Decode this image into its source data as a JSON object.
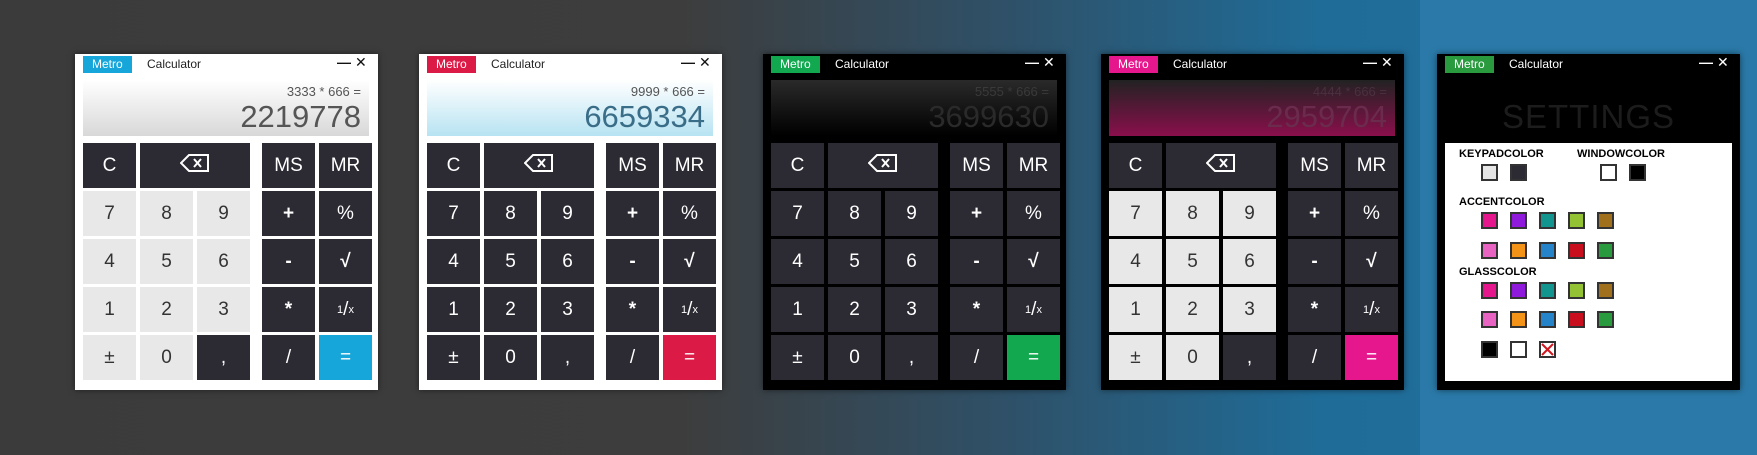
{
  "app_badge": "Metro",
  "app_title": "Calculator",
  "minimize_symbol": "—",
  "close_symbol": "✕",
  "calculators": [
    {
      "accent": "#16a6d9",
      "expression": "3333 * 666 =",
      "result": "2219778"
    },
    {
      "accent": "#db1b46",
      "expression": "9999 * 666 =",
      "result": "6659334"
    },
    {
      "accent": "#11a84f",
      "expression": "5555 * 666 =",
      "result": "3699630"
    },
    {
      "accent": "#e6168c",
      "expression": "4444 * 666 =",
      "result": "2959704"
    }
  ],
  "keys": {
    "clear": "C",
    "ms": "MS",
    "mr": "MR",
    "d7": "7",
    "d8": "8",
    "d9": "9",
    "plus": "+",
    "percent": "%",
    "d4": "4",
    "d5": "5",
    "d6": "6",
    "minus": "-",
    "sqrt": "√",
    "d1": "1",
    "d2": "2",
    "d3": "3",
    "multiply": "*",
    "recip_num": "1",
    "recip_slash": "/",
    "recip_den": "x",
    "plusminus": "±",
    "d0": "0",
    "comma": ",",
    "divide": "/",
    "equals": "="
  },
  "settings": {
    "accent": "#2a9a3e",
    "title": "SETTINGS",
    "keypad_label": "KEYPADCOLOR",
    "window_label": "WINDOWCOLOR",
    "accent_label": "ACCENTCOLOR",
    "glass_label": "GLASSCOLOR",
    "keypad_colors": [
      "#e6e6e6",
      "#2c2b34"
    ],
    "window_colors": [
      "#ffffff",
      "#000000"
    ],
    "accent_colors": [
      "#e6168c",
      "#8f1adb",
      "#13958f",
      "#93c235",
      "#a0701c",
      "#e964c2",
      "#f39418",
      "#2483c9",
      "#c90f1e",
      "#2a9a3e"
    ],
    "glass_colors": [
      "#e6168c",
      "#8f1adb",
      "#13958f",
      "#93c235",
      "#a0701c",
      "#e964c2",
      "#f39418",
      "#2483c9",
      "#c90f1e",
      "#2a9a3e"
    ],
    "glass_extra": [
      "#000000",
      "#ffffff"
    ]
  }
}
